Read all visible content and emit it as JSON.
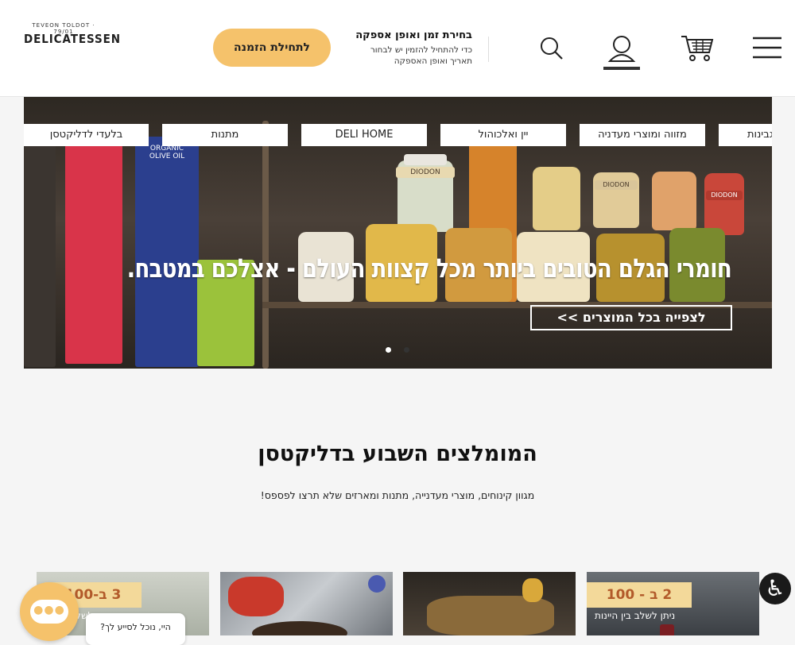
{
  "header": {
    "logo_arc": "TEVEON TOLDOT · 79/01",
    "logo_word": "DELICATESSEN",
    "cta_label": "לתחילת הזמנה",
    "info_title": "בחירת זמן ואופן אספקה",
    "info_line1": "כדי להתחיל להזמין יש לבחור",
    "info_line2": "תאריך ואופן האספקה",
    "icons": [
      "search-icon",
      "user-icon",
      "cart-icon",
      "menu-icon"
    ]
  },
  "categories": [
    "בלעדי לדליקטסן",
    "מתנות",
    "DELI HOME",
    "יין ואלכוהול",
    "מזווה ומוצרי מעדניה",
    "גבינות"
  ],
  "hero": {
    "title": "חומרי הגלם הטובים ביותר מכל קצוות העולם - אצלכם במטבח.",
    "button": "לצפייה בכל המוצרים >>",
    "product_labels": [
      "ORGANIC EXTRA VIRGIN OLIVE OIL",
      "ORGANIC OLIVE OIL",
      "DIODON",
      "DIODON",
      "DIODON"
    ]
  },
  "section": {
    "title": "המומלצים השבוע בדליקטסן",
    "subtitle": "מגוון קינוחים, מוצרי מעדנייה, מתנות ומארזים שלא תרצו לפספס!"
  },
  "cards": [
    {
      "badge": "3 ב-100",
      "text": "ניתן לשלב ב..."
    },
    {
      "badge": "",
      "text": ""
    },
    {
      "badge": "",
      "text": ""
    },
    {
      "badge": "2 ב - 100",
      "text": "ניתן לשלב בין היינות"
    }
  ],
  "chat": {
    "tip": "היי, נוכל לסייע לך?"
  },
  "colors": {
    "accent": "#f5c26b",
    "badge": "#f3d99a"
  }
}
